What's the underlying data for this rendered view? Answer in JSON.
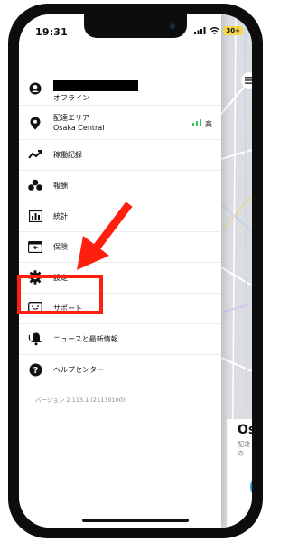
{
  "status_bar": {
    "time": "19:31",
    "battery": "30+"
  },
  "menu": {
    "profile_status": "オフライン",
    "area_title": "配達エリア",
    "area_name": "Osaka Central",
    "area_signal": "高",
    "items": [
      {
        "label": "稼働記録",
        "icon": "chart-line-icon"
      },
      {
        "label": "報酬",
        "icon": "coins-icon"
      },
      {
        "label": "統計",
        "icon": "bar-chart-icon"
      },
      {
        "label": "保険",
        "icon": "insurance-card-icon"
      },
      {
        "label": "設定",
        "icon": "gear-icon"
      },
      {
        "label": "サポート",
        "icon": "support-chat-icon"
      },
      {
        "label": "ニュースと最新情報",
        "icon": "bell-icon"
      },
      {
        "label": "ヘルプセンター",
        "icon": "help-icon"
      }
    ],
    "version": "バージョン 2.113.1 (21130100)"
  },
  "map": {
    "card_title": "Osa",
    "card_subtitle": "配達の"
  },
  "colors": {
    "highlight": "#ff1f0f",
    "signal": "#34c759",
    "accent_blue": "#2e9fd7"
  }
}
